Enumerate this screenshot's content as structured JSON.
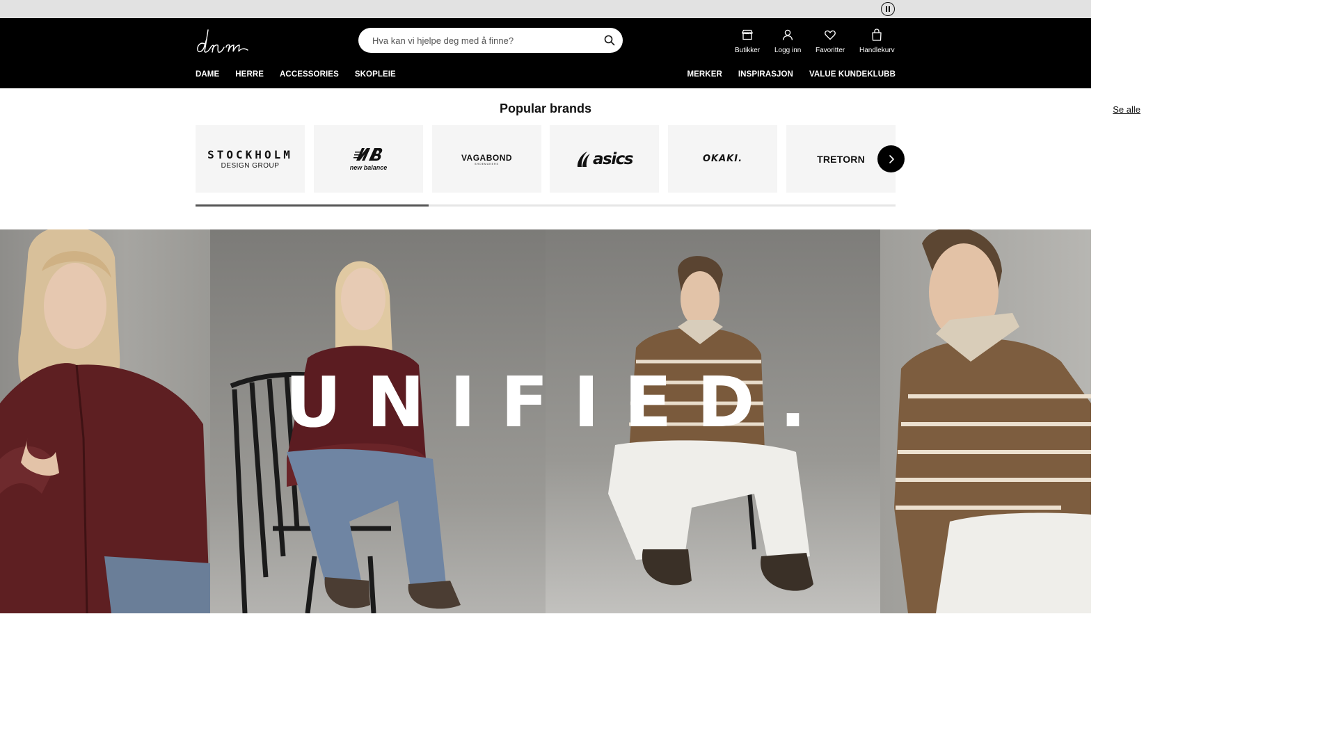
{
  "topbar": {
    "pause_label": "pause"
  },
  "header": {
    "search_placeholder": "Hva kan vi hjelpe deg med å finne?",
    "utilities": [
      {
        "label": "Butikker",
        "icon": "store-icon"
      },
      {
        "label": "Logg inn",
        "icon": "user-icon"
      },
      {
        "label": "Favoritter",
        "icon": "heart-icon"
      },
      {
        "label": "Handlekurv",
        "icon": "bag-icon"
      }
    ],
    "nav_left": [
      "DAME",
      "HERRE",
      "ACCESSORIES",
      "SKOPLEIE"
    ],
    "nav_right": [
      "MERKER",
      "INSPIRASJON",
      "VALUE KUNDEKLUBB"
    ]
  },
  "brands": {
    "title": "Popular brands",
    "see_all": "Se alle",
    "items": [
      {
        "name": "STOCKHOLM",
        "sub": "DESIGN GROUP"
      },
      {
        "name": "new balance"
      },
      {
        "name": "VAGABOND",
        "sub": "SHOEMAKERS"
      },
      {
        "name": "asics"
      },
      {
        "name": "OKAKI."
      },
      {
        "name": "TRETORN"
      }
    ],
    "scroll_progress": 0.333
  },
  "hero": {
    "headline": "UNIFIED."
  },
  "colors": {
    "header_bg": "#000000",
    "topbar_bg": "#e2e2e2",
    "card_bg": "#f5f5f5"
  }
}
